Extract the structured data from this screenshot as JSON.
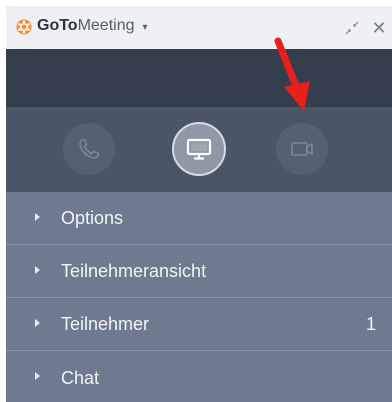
{
  "titlebar": {
    "brand_bold": "GoTo",
    "brand_light": "Meeting",
    "caret": "▾",
    "close_label": "✕"
  },
  "toolbar": {
    "buttons": [
      {
        "name": "phone",
        "icon": "phone-icon",
        "state": "inactive"
      },
      {
        "name": "screen",
        "icon": "monitor-icon",
        "state": "active"
      },
      {
        "name": "camera",
        "icon": "video-camera-icon",
        "state": "inactive"
      }
    ]
  },
  "annotation": {
    "color": "#e8201c"
  },
  "menu": {
    "items": [
      {
        "label": "Options",
        "count": ""
      },
      {
        "label": "Teilnehmeransicht",
        "count": ""
      },
      {
        "label": "Teilnehmer",
        "count": "1"
      },
      {
        "label": "Chat",
        "count": ""
      }
    ]
  },
  "colors": {
    "titlebar": "#eef0f3",
    "dark_header": "#353e4c",
    "toolbar": "#4a5566",
    "menu_item": "#6e7a8e",
    "brand_orange": "#f68d2e"
  }
}
